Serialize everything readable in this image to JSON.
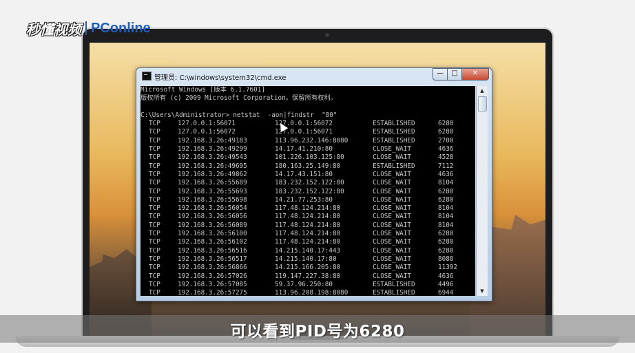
{
  "watermark": {
    "brand": "秒懂视频",
    "site": "PConline"
  },
  "window": {
    "title": "管理员: C:\\windows\\system32\\cmd.exe",
    "minimize_glyph": "—",
    "maximize_glyph": "□",
    "close_glyph": "✕"
  },
  "console": {
    "banner_1": "Microsoft Windows [版本 6.1.7601]",
    "banner_2": "版权所有 (c) 2009 Microsoft Corporation。保留所有权利。",
    "command": "C:\\Users\\Administrator> netstat  -aon|findstr  \"80\"",
    "rows": [
      [
        "TCP",
        "127.0.0.1:56071",
        "127.0.0.1:56072",
        "ESTABLISHED",
        "6280"
      ],
      [
        "TCP",
        "127.0.0.1:56072",
        "127.0.0.1:56071",
        "ESTABLISHED",
        "6280"
      ],
      [
        "TCP",
        "192.168.3.26:49183",
        "113.96.232.146:8080",
        "ESTABLISHED",
        "2700"
      ],
      [
        "TCP",
        "192.168.3.26:49299",
        "14.17.41.210:80",
        "CLOSE_WAIT",
        "4636"
      ],
      [
        "TCP",
        "192.168.3.26:49543",
        "101.226.103.125:80",
        "CLOSE_WAIT",
        "4528"
      ],
      [
        "TCP",
        "192.168.3.26:49695",
        "180.163.25.149:80",
        "ESTABLISHED",
        "7112"
      ],
      [
        "TCP",
        "192.168.3.26:49862",
        "14.17.43.151:80",
        "CLOSE_WAIT",
        "4636"
      ],
      [
        "TCP",
        "192.168.3.26:55689",
        "183.232.152.122:80",
        "CLOSE_WAIT",
        "8104"
      ],
      [
        "TCP",
        "192.168.3.26:55693",
        "183.232.152.122:80",
        "CLOSE_WAIT",
        "6280"
      ],
      [
        "TCP",
        "192.168.3.26:55698",
        "14.21.77.253:80",
        "CLOSE_WAIT",
        "6280"
      ],
      [
        "TCP",
        "192.168.3.26:56054",
        "117.48.124.214:80",
        "CLOSE_WAIT",
        "8104"
      ],
      [
        "TCP",
        "192.168.3.26:56056",
        "117.48.124.214:80",
        "CLOSE_WAIT",
        "8104"
      ],
      [
        "TCP",
        "192.168.3.26:56089",
        "117.48.124.214:80",
        "CLOSE_WAIT",
        "8104"
      ],
      [
        "TCP",
        "192.168.3.26:56100",
        "117.48.124.214:80",
        "CLOSE_WAIT",
        "6280"
      ],
      [
        "TCP",
        "192.168.3.26:56102",
        "117.48.124.214:80",
        "CLOSE_WAIT",
        "6280"
      ],
      [
        "TCP",
        "192.168.3.26:56516",
        "14.215.140.17:443",
        "CLOSE_WAIT",
        "6280"
      ],
      [
        "TCP",
        "192.168.3.26:56517",
        "14.215.140.17:80",
        "CLOSE_WAIT",
        "8088"
      ],
      [
        "TCP",
        "192.168.3.26:56866",
        "14.215.166.205:80",
        "CLOSE_WAIT",
        "11392"
      ],
      [
        "TCP",
        "192.168.3.26:57026",
        "119.147.227.38:80",
        "CLOSE_WAIT",
        "4636"
      ],
      [
        "TCP",
        "192.168.3.26:57085",
        "59.37.96.250:80",
        "ESTABLISHED",
        "4496"
      ],
      [
        "TCP",
        "192.168.3.26:57275",
        "113.96.208.198:8080",
        "ESTABLISHED",
        "6944"
      ]
    ]
  },
  "subtitle": "可以看到PID号为6280",
  "colors": {
    "console_bg": "#000000",
    "console_text": "#c8c8c8",
    "close_button": "#c44b33",
    "watermark_site": "#1f5fbf"
  }
}
